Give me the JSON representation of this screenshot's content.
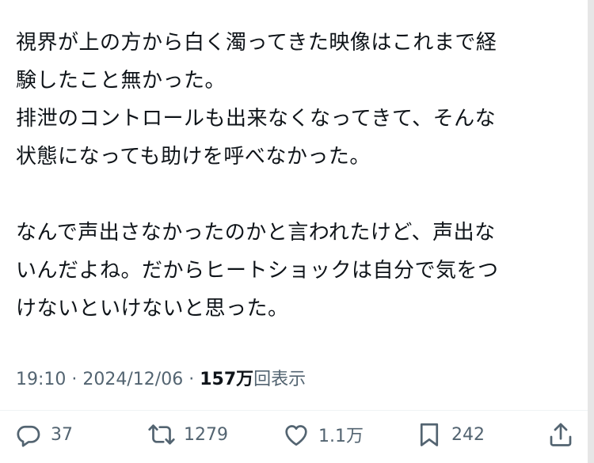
{
  "post": {
    "lines": [
      "視界が上の方から白く濁ってきた映像はこれまで経",
      "験したこと無かった。",
      "排泄のコントロールも出来なくなってきて、そんな",
      "状態になっても助けを呼べなかった。",
      "",
      "なんで声出さなかったのかと言われたけど、声出な",
      "いんだよね。だからヒートショックは自分で気をつ",
      "けないといけないと思った。"
    ],
    "time": "19:10",
    "separator": "·",
    "date": "2024/12/06",
    "views_count": "157万",
    "views_label": "回表示"
  },
  "actions": {
    "reply_count": "37",
    "retweet_count": "1279",
    "like_count": "1.1万",
    "bookmark_count": "242"
  },
  "icons": {
    "reply": "reply-icon",
    "retweet": "retweet-icon",
    "like": "heart-icon",
    "bookmark": "bookmark-icon",
    "share": "share-icon"
  },
  "colors": {
    "text": "#0f1419",
    "secondary": "#536471",
    "divider": "#eff3f4"
  }
}
